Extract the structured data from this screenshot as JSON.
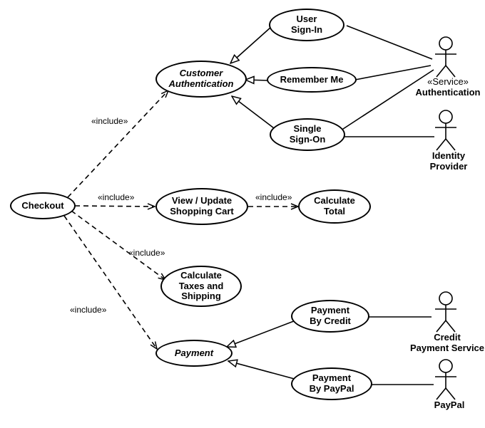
{
  "usecases": {
    "checkout": "Checkout",
    "customer_auth": "Customer\nAuthentication",
    "user_signin": "User\nSign-In",
    "remember_me": "Remember Me",
    "single_signon": "Single\nSign-On",
    "view_update_cart": "View / Update\nShopping Cart",
    "calculate_total": "Calculate\nTotal",
    "calculate_taxes": "Calculate\nTaxes and\nShipping",
    "payment": "Payment",
    "payment_credit": "Payment\nBy Credit",
    "payment_paypal": "Payment\nBy PayPal"
  },
  "actors": {
    "authentication_stereo": "«Service»",
    "authentication": "Authentication",
    "identity_provider": "Identity\nProvider",
    "credit_service": "Credit\nPayment Service",
    "paypal": "PayPal"
  },
  "labels": {
    "include": "«include»"
  }
}
